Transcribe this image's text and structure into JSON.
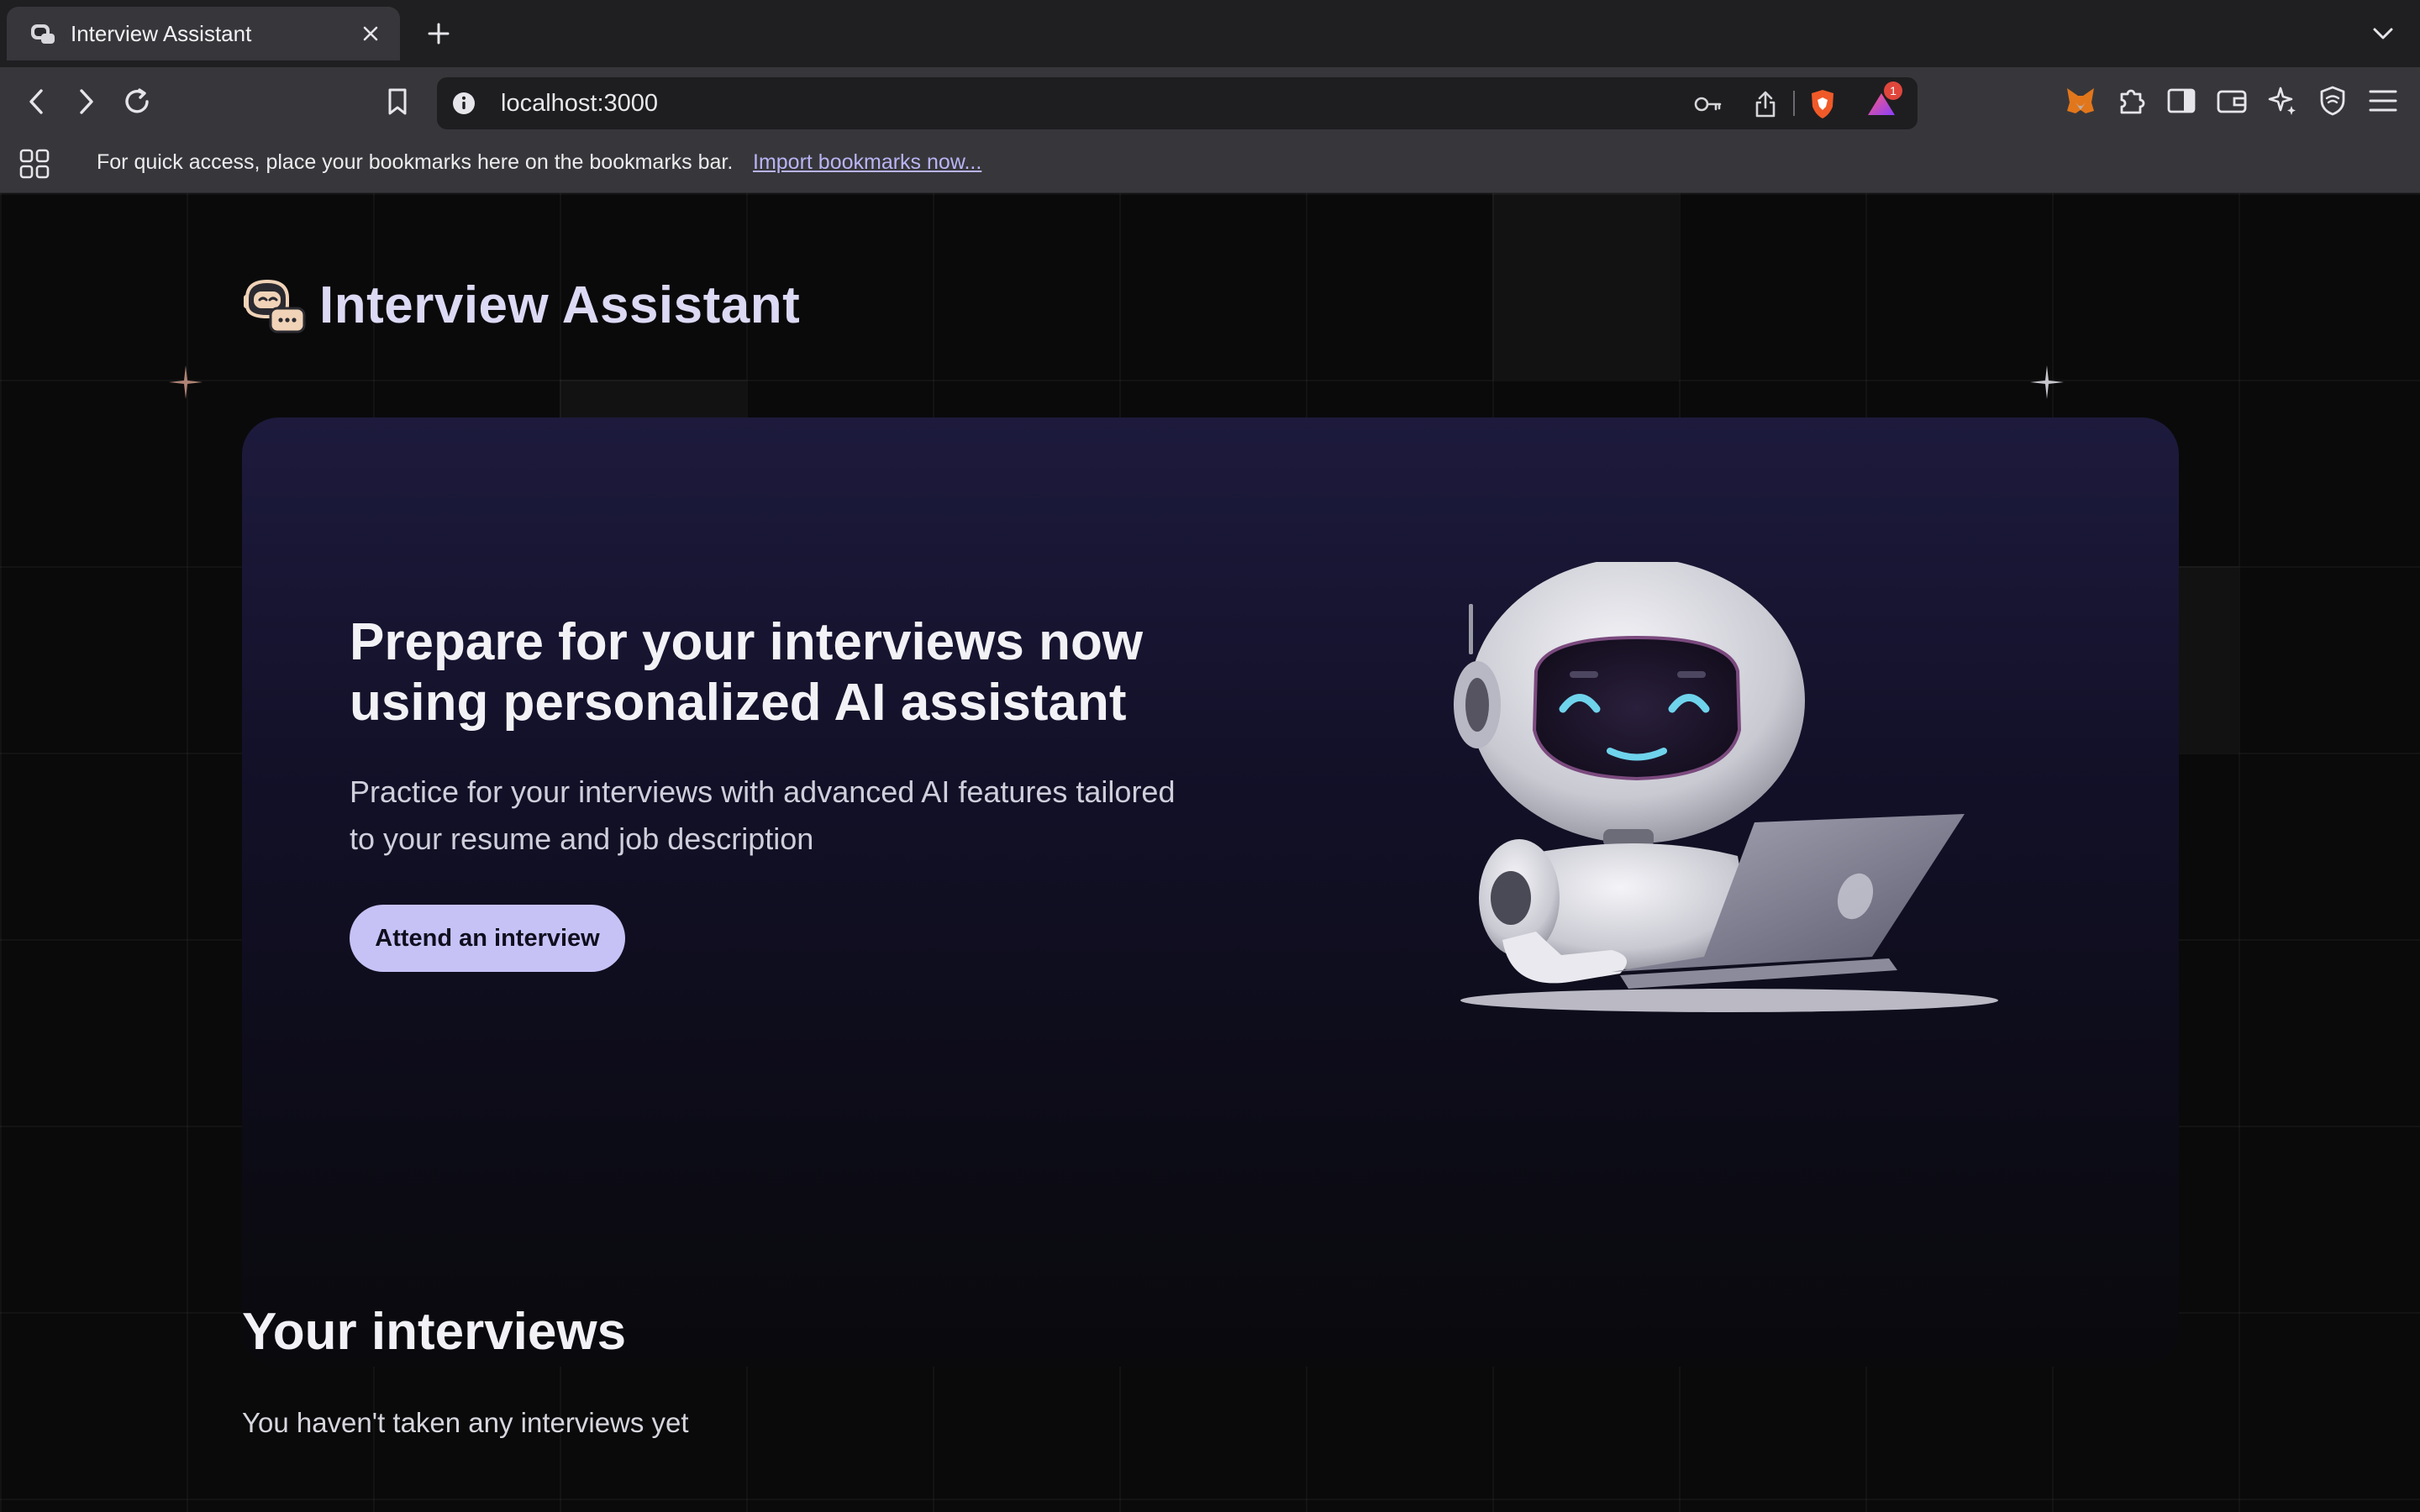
{
  "browser": {
    "tab": {
      "title": "Interview Assistant",
      "favicon": "robot-icon"
    },
    "address": {
      "url": "localhost:3000"
    },
    "shields_badge": "1",
    "bookmarks_bar": {
      "message": "For quick access, place your bookmarks here on the bookmarks bar.",
      "import_link": "Import bookmarks now..."
    }
  },
  "app": {
    "title": "Interview Assistant",
    "hero": {
      "title": "Prepare for your interviews now using personalized AI assistant",
      "subtitle": "Practice for your interviews with advanced AI features tailored to your resume and job description",
      "cta_label": "Attend an interview",
      "illustration": "robot-with-laptop"
    },
    "interviews": {
      "title": "Your interviews",
      "empty_message": "You haven't taken any interviews yet"
    }
  },
  "colors": {
    "accent": "#c6c2f6",
    "hero_top": "#1d1a3d",
    "page_bg": "#0a0a0b",
    "browser_chrome": "#37373b"
  }
}
